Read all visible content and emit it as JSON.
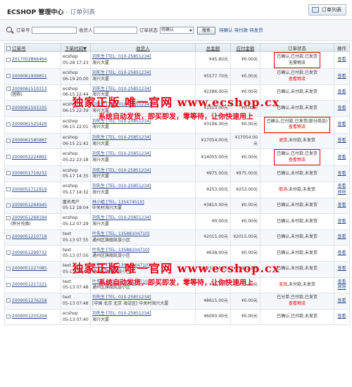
{
  "header": {
    "brand": "ECSHOP 管理中心",
    "breadcrumb": " - 订单列表",
    "order_list_button": "订单列表"
  },
  "filter": {
    "order_sn_label": "订单号",
    "consignee_label": "收货人",
    "status_label": "订单状态",
    "status_selected": "待确认",
    "search_button": "搜索",
    "quick_links": "待确认 待付款 待发货"
  },
  "table": {
    "columns": [
      "订单号",
      "下单时间▼",
      "收货人",
      "总金额",
      "应付金额",
      "订单状态",
      "操作"
    ],
    "rows": [
      {
        "sn": "2017052866464",
        "note": "",
        "user": "ecshop",
        "time": "05-28 17:23",
        "consignee": "刘先生 [TEL: 010-25851234]",
        "addr": "海兴大厦",
        "amount": "¥45.60元",
        "payable": "¥0.00元",
        "status1": "已确认,已付款,已发货",
        "status2": "无需物流",
        "status2_red": false,
        "boxed": true,
        "actions": [
          "查看"
        ]
      },
      {
        "sn": "2009061909851",
        "note": "",
        "user": "ecshop",
        "time": "06-19 20:00",
        "consignee": "刘先生 [TEL: 010-25851234]",
        "addr": "海兴大厦",
        "amount": "¥5577.70元",
        "payable": "¥0.00元",
        "status1": "已确认,已付款,已发货",
        "status2": "查看物流",
        "status2_red": true,
        "boxed": false,
        "actions": [
          "查看"
        ]
      },
      {
        "sn": "2009061510313",
        "note": "(团购)",
        "user": "ecshop",
        "time": "06-15 22:44",
        "consignee": "刘先生 [TEL: 010-25851234]",
        "addr": "海兴大厦",
        "amount": "¥2286.00元",
        "payable": "¥0.00元",
        "status1": "已确认,未付款,未发货",
        "status2": "",
        "status2_red": false,
        "boxed": false,
        "actions": [
          "查看"
        ]
      },
      {
        "sn": "2009061503335",
        "note": "",
        "user": "ecshop",
        "time": "06-15 22:39",
        "consignee": "刘先生 [TEL: 010-25851234]",
        "addr": "海兴大厦",
        "amount": "¥1910.00元",
        "payable": "¥0.00元",
        "status1": "已确认,未付款,未发货",
        "status2": "",
        "status2_red": false,
        "boxed": false,
        "actions": [
          "查看"
        ]
      },
      {
        "sn": "2009061525429",
        "note": "",
        "user": "ecshop",
        "time": "06-15 22:01",
        "consignee": "刘先生 [TEL: 010-25851234]",
        "addr": "海兴大厦",
        "amount": "¥3196.30元",
        "payable": "¥0.00元",
        "status1": "已确认,已付款,已发货(部分商品)",
        "status2": "查看物流",
        "status2_red": true,
        "boxed": true,
        "actions": [
          "查看"
        ]
      },
      {
        "sn": "2009061585887",
        "note": "",
        "user": "ecshop",
        "time": "06-15 21:42",
        "consignee": "刘先生 [TEL: 010-25851234]",
        "addr": "海兴大厦",
        "amount": "¥17054.00元",
        "payable": "¥17054.00元",
        "status1_red": "退货",
        "status1": ",未付款,未发货",
        "status2": "",
        "status2_red": false,
        "boxed": false,
        "actions": [
          "查看"
        ]
      },
      {
        "sn": "2009052224892",
        "note": "",
        "user": "ecshop",
        "time": "05-22 23:18",
        "consignee": "刘先生 [TEL: 010-25851234]",
        "addr": "海兴大厦",
        "amount": "¥14055.00元",
        "payable": "¥0.00元",
        "status1": "已确认,已付款,已发货",
        "status2": "查看物流",
        "status2_red": true,
        "boxed": true,
        "actions": [
          "查看"
        ]
      },
      {
        "sn": "2009051719232",
        "note": "",
        "user": "ecshop",
        "time": "05-17 14:35",
        "consignee": "刘先生 [TEL: 010-25851234]",
        "addr": "海兴大厦",
        "amount": "¥975.00元",
        "payable": "¥975.00元",
        "status1": "已确认,未付款,未发货",
        "status2": "",
        "status2_red": false,
        "boxed": false,
        "actions": [
          "查看"
        ]
      },
      {
        "sn": "2009051712919",
        "note": "",
        "user": "ecshop",
        "time": "05-17 14:32",
        "consignee": "刘先生 [TEL: 010-25851234]",
        "addr": "海兴大厦",
        "amount": "¥253.00元",
        "payable": "¥253.00元",
        "status1_red": "取消",
        "status1": ",未付款,未发货",
        "status2": "",
        "status2_red": false,
        "boxed": false,
        "actions": [
          "查看",
          "移除"
        ]
      },
      {
        "sn": "2009051264945",
        "note": "",
        "user": "匿名用户",
        "time": "05-12 18:04",
        "consignee": "林小姐 [TEL: 135474510]",
        "addr": "中关村海兴大厦",
        "amount": "¥3810.00元",
        "payable": "¥0.00元",
        "status1": "已确认,未付款,未发货",
        "status2": "",
        "status2_red": false,
        "boxed": false,
        "actions": [
          "查看"
        ]
      },
      {
        "sn": "2009051268194",
        "note": "(积分兑换)",
        "user": "ecshop",
        "time": "05-12 07:29",
        "consignee": "刘先生 [TEL: 010-25851234]",
        "addr": "海兴大厦",
        "amount": "¥0.00元",
        "payable": "¥0.00元",
        "status1": "已确认,未付款,未发货",
        "status2": "",
        "status2_red": false,
        "boxed": false,
        "actions": [
          "查看"
        ]
      },
      {
        "sn": "2009051210718",
        "note": "",
        "user": "text",
        "time": "05-13 07:55",
        "consignee": "叶先生 [TEL: 13588104710]",
        "addr": "通州区旗舰凯旋小区",
        "amount": "¥2015.00元",
        "payable": "¥2015.00元",
        "status1": "已确认,未付款,未发货",
        "status2": "",
        "status2_red": false,
        "boxed": false,
        "actions": [
          "查看"
        ]
      },
      {
        "sn": "2009051299732",
        "note": "",
        "user": "text",
        "time": "05-13 07:50",
        "consignee": "叶先生 [TEL: 13588104710]",
        "addr": "通州区旗舰凯旋小区",
        "amount": "¥638.00元",
        "payable": "¥0.00元",
        "status1": "已确认,未付款,未发货",
        "status2": "",
        "status2_red": false,
        "boxed": false,
        "actions": [
          "查看"
        ]
      },
      {
        "sn": "2009051227085",
        "note": "",
        "user": "text",
        "time": "05-13 07:49",
        "consignee": "叶先生 [TEL: 13588104710]",
        "addr": "通州区旗舰凯旋小区",
        "amount": "¥2313.00元",
        "payable": "¥1198.10元",
        "status1": "已确认,未付款,未发货",
        "status2": "",
        "status2_red": false,
        "boxed": false,
        "actions": [
          "查看"
        ]
      },
      {
        "sn": "2009051217221",
        "note": "",
        "user": "text",
        "time": "05-13 07:48",
        "consignee": "叶先生 [TEL: 13588104710]",
        "addr": "通州区旗舰凯旋小区",
        "amount": "¥35.00元",
        "payable": "¥35.00元",
        "status1_red": "无效",
        "status1": ",未付款,未发货",
        "status2": "",
        "status2_red": false,
        "boxed": false,
        "actions": [
          "查看",
          "移除"
        ]
      },
      {
        "sn": "2009051276258",
        "note": "",
        "user": "text",
        "time": "05-13 07:48",
        "consignee": "刘先生 [TEL: 010-25851234]",
        "addr": "[中国 北京 北京 海淀区] 中关村海兴大厦",
        "amount": "¥8615.00元",
        "payable": "¥0.00元",
        "status1": "已分单,已付款,已发货",
        "status2": "查看物流",
        "status2_red": true,
        "boxed": false,
        "actions": [
          "查看"
        ]
      },
      {
        "sn": "2009051255204",
        "note": "",
        "user": "ecshop",
        "time": "05-13 07:40",
        "consignee": "刘先生 [TEL: 010-25851234]",
        "addr": "海兴大厦",
        "amount": "¥6000.00元",
        "payable": "¥0.00元",
        "status1": "已确认,已付款,未发货",
        "status2": "",
        "status2_red": false,
        "boxed": false,
        "actions": [
          "查看"
        ]
      }
    ]
  },
  "watermark": {
    "line1": "独家正版 唯一官网 www.ecshop.cx",
    "line2": "系统自动发货，即买即发，零等待，让你快速用上"
  },
  "colors": {
    "accent_link": "#2a4c8c",
    "status_red": "#d40000",
    "watermark_red": "#e60012"
  }
}
